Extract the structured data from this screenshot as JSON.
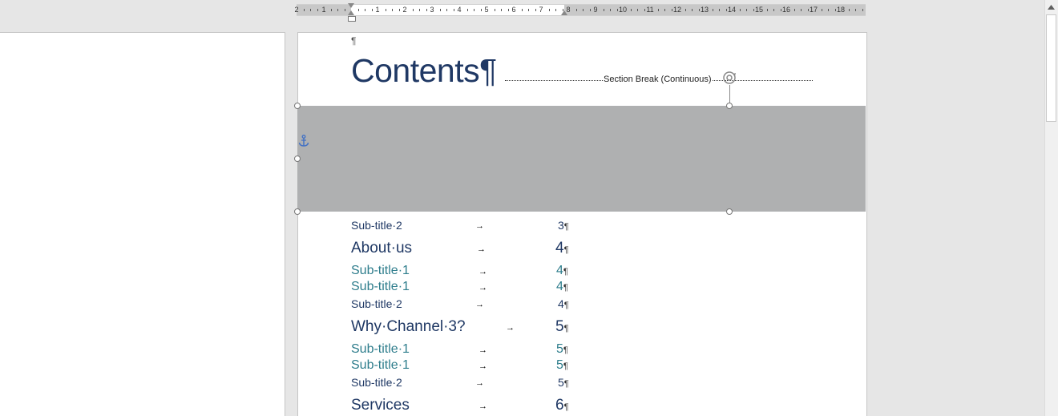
{
  "ruler": {
    "numbers": [
      "2",
      "1",
      "1",
      "2",
      "3",
      "4",
      "5",
      "6",
      "7",
      "8",
      "9",
      "10",
      "11",
      "12",
      "13",
      "14",
      "15",
      "16",
      "17",
      "18"
    ]
  },
  "document": {
    "top_pilcrow": "¶",
    "heading": "Contents¶",
    "section_break_label": "Section Break (Continuous)",
    "toc": [
      {
        "text": "Sub-title·2",
        "page": "3",
        "level": 3
      },
      {
        "text": "About·us",
        "page": "4",
        "level": 1
      },
      {
        "text": "Sub-title·1",
        "page": "4",
        "level": 2
      },
      {
        "text": "Sub-title·1",
        "page": "4",
        "level": 2
      },
      {
        "text": "Sub-title·2",
        "page": "4",
        "level": 3
      },
      {
        "text": "Why·Channel·3?",
        "page": "5",
        "level": 1
      },
      {
        "text": "Sub-title·1",
        "page": "5",
        "level": 2
      },
      {
        "text": "Sub-title·1",
        "page": "5",
        "level": 2
      },
      {
        "text": "Sub-title·2",
        "page": "5",
        "level": 3
      },
      {
        "text": "Services",
        "page": "6",
        "level": 1
      }
    ],
    "tab_arrow": "→",
    "pilcrow": "¶"
  },
  "icons": {
    "anchor": "anchor-icon",
    "rotate": "rotate-handle-icon",
    "scroll_up": "scroll-up-icon"
  },
  "colors": {
    "heading": "#1f3864",
    "subtitle1": "#2e7d8c",
    "shape_fill": "#afb0b1"
  }
}
